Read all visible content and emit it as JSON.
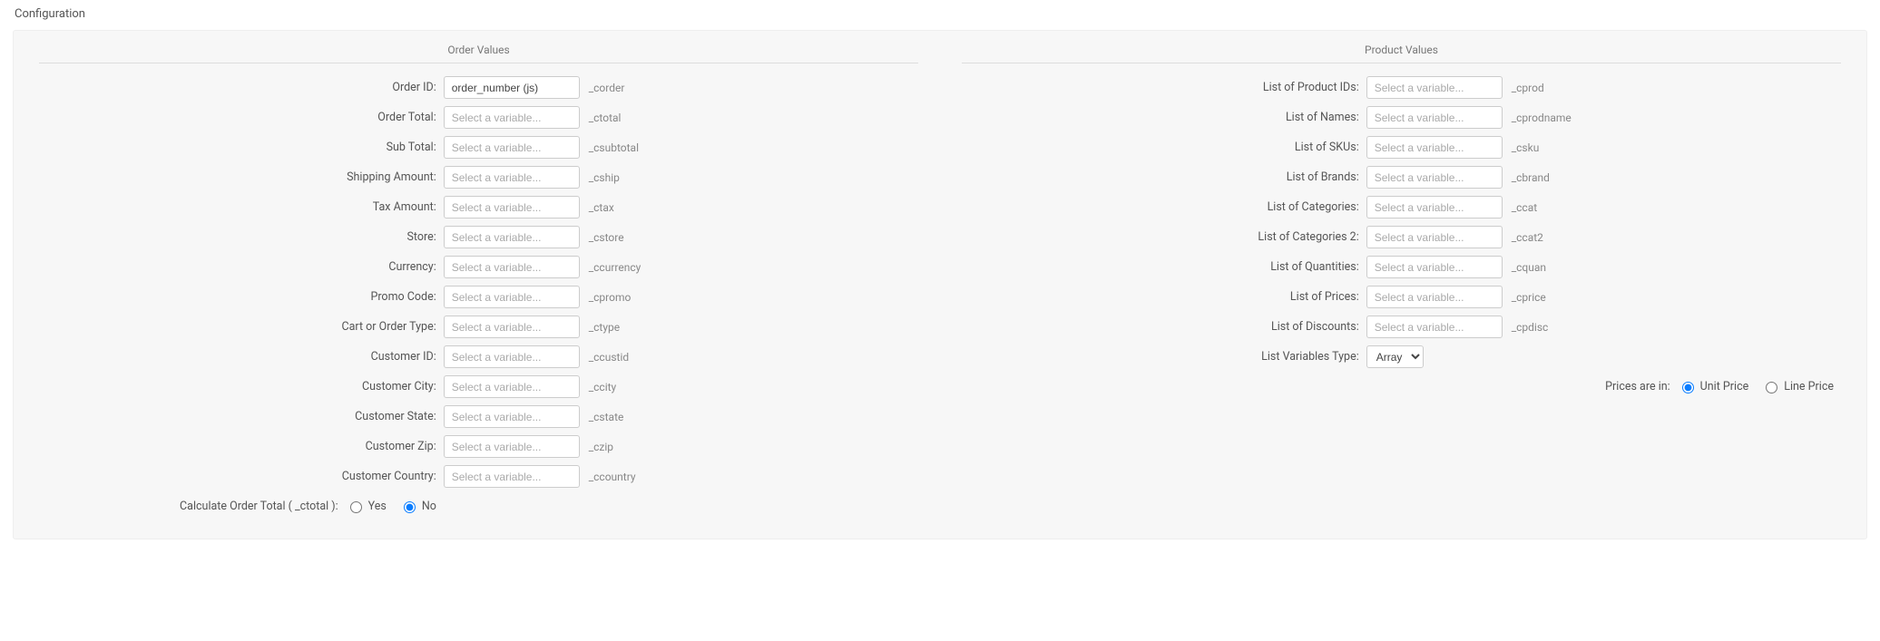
{
  "title": "Configuration",
  "shared": {
    "placeholder": "Select a variable..."
  },
  "order": {
    "heading": "Order Values",
    "calc_label": "Calculate Order Total ( _ctotal ):",
    "calc_opts": {
      "yes": "Yes",
      "no": "No"
    },
    "fields": [
      {
        "label": "Order ID:",
        "value": "order_number (js)",
        "code": "_corder"
      },
      {
        "label": "Order Total:",
        "value": "",
        "code": "_ctotal"
      },
      {
        "label": "Sub Total:",
        "value": "",
        "code": "_csubtotal"
      },
      {
        "label": "Shipping Amount:",
        "value": "",
        "code": "_cship"
      },
      {
        "label": "Tax Amount:",
        "value": "",
        "code": "_ctax"
      },
      {
        "label": "Store:",
        "value": "",
        "code": "_cstore"
      },
      {
        "label": "Currency:",
        "value": "",
        "code": "_ccurrency"
      },
      {
        "label": "Promo Code:",
        "value": "",
        "code": "_cpromo"
      },
      {
        "label": "Cart or Order Type:",
        "value": "",
        "code": "_ctype"
      },
      {
        "label": "Customer ID:",
        "value": "",
        "code": "_ccustid"
      },
      {
        "label": "Customer City:",
        "value": "",
        "code": "_ccity"
      },
      {
        "label": "Customer State:",
        "value": "",
        "code": "_cstate"
      },
      {
        "label": "Customer Zip:",
        "value": "",
        "code": "_czip"
      },
      {
        "label": "Customer Country:",
        "value": "",
        "code": "_ccountry"
      }
    ]
  },
  "product": {
    "heading": "Product Values",
    "list_type_label": "List Variables Type:",
    "list_type_option": "Array",
    "prices_label": "Prices are in:",
    "prices_opts": {
      "unit": "Unit Price",
      "line": "Line Price"
    },
    "fields": [
      {
        "label": "List of Product IDs:",
        "value": "",
        "code": "_cprod"
      },
      {
        "label": "List of Names:",
        "value": "",
        "code": "_cprodname"
      },
      {
        "label": "List of SKUs:",
        "value": "",
        "code": "_csku"
      },
      {
        "label": "List of Brands:",
        "value": "",
        "code": "_cbrand"
      },
      {
        "label": "List of Categories:",
        "value": "",
        "code": "_ccat"
      },
      {
        "label": "List of Categories 2:",
        "value": "",
        "code": "_ccat2"
      },
      {
        "label": "List of Quantities:",
        "value": "",
        "code": "_cquan"
      },
      {
        "label": "List of Prices:",
        "value": "",
        "code": "_cprice"
      },
      {
        "label": "List of Discounts:",
        "value": "",
        "code": "_cpdisc"
      }
    ]
  }
}
